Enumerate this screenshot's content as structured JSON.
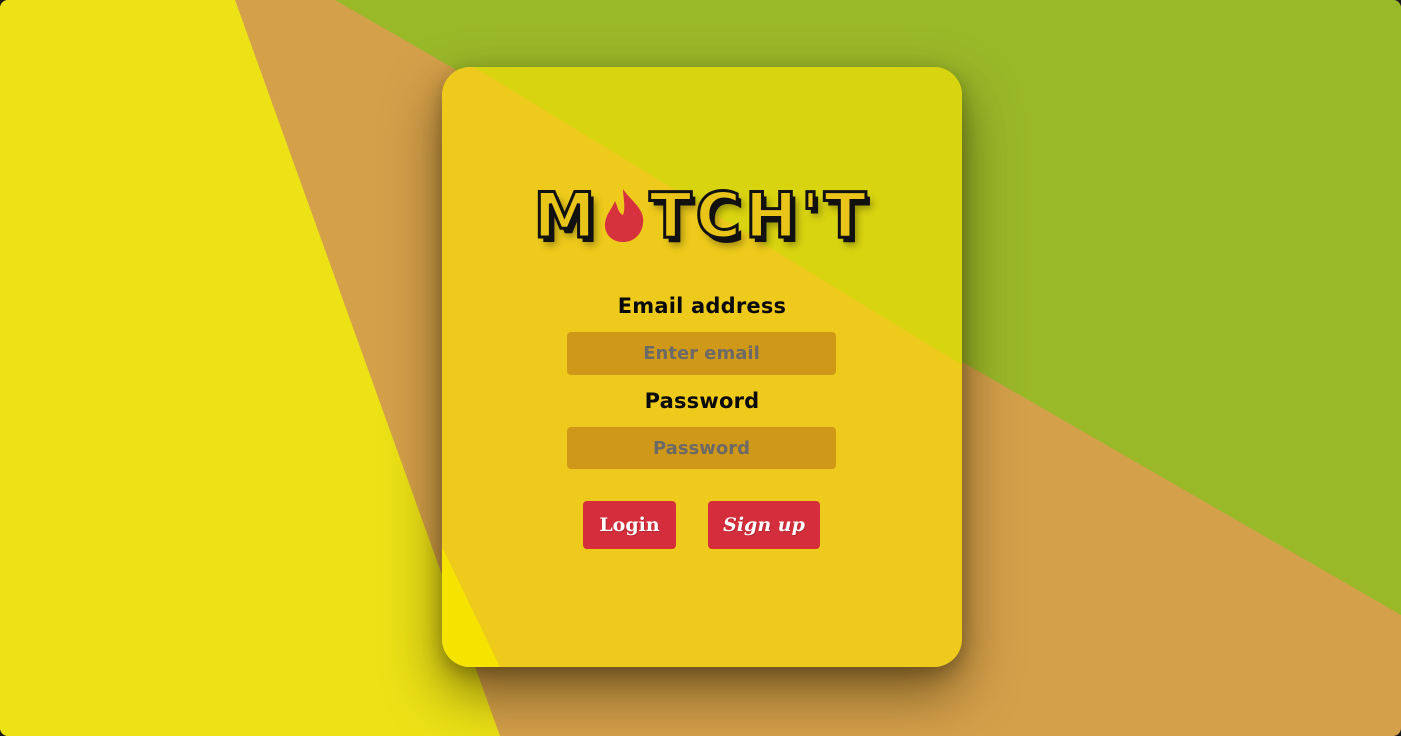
{
  "app": {
    "logo_text_left": "M",
    "logo_text_right": "TCH'T",
    "logo_icon": "flame-icon"
  },
  "form": {
    "email_label": "Email address",
    "email_placeholder": "Enter email",
    "email_value": "",
    "password_label": "Password",
    "password_placeholder": "Password",
    "password_value": ""
  },
  "buttons": {
    "login_label": "Login",
    "signup_label": "Sign up"
  },
  "colors": {
    "background_yellow": "#ECE216",
    "background_tan": "#D4A04A",
    "background_green": "#9AB929",
    "card_yellow": "#EDCA1B",
    "input_fill": "#CF9818",
    "button_red": "#D42E3C",
    "flame_red": "#D6323E"
  }
}
